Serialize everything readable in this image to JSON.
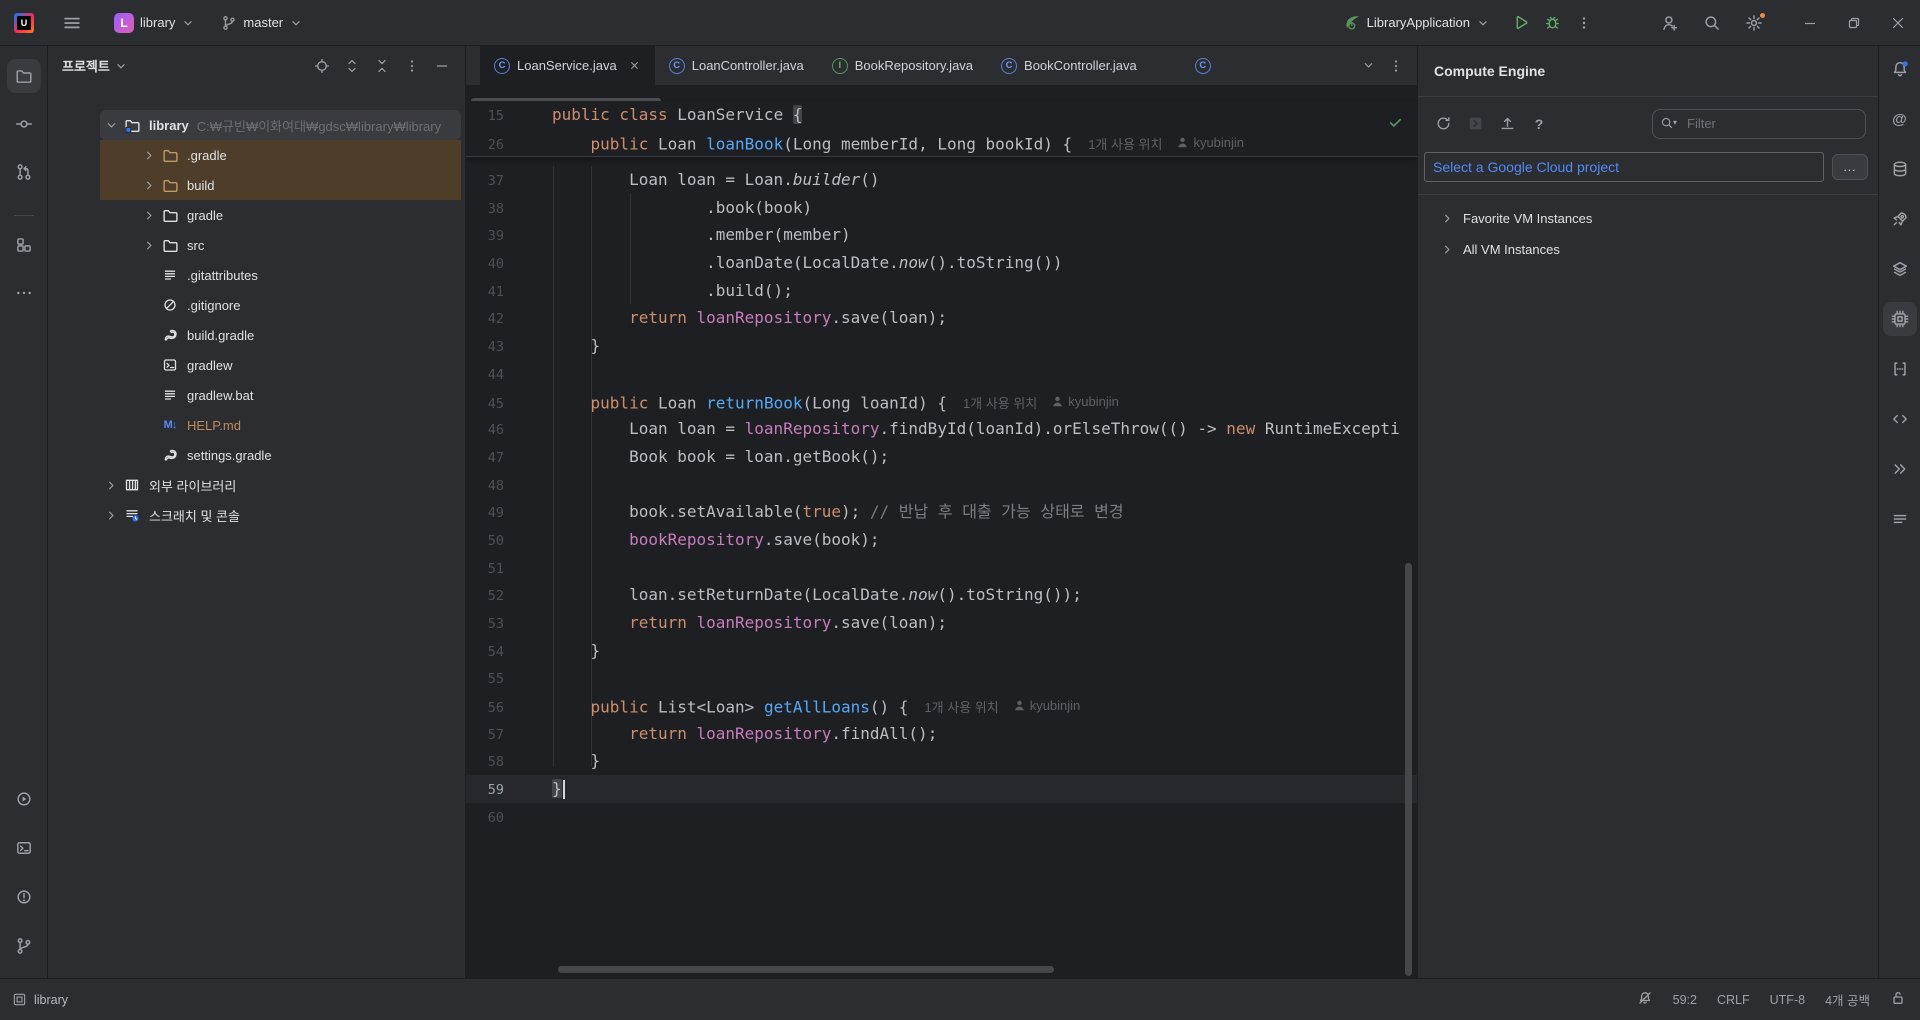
{
  "title_bar": {
    "project_name": "library",
    "branch": "master",
    "run_config": "LibraryApplication"
  },
  "left_stripe": {
    "top": [
      "project-folder",
      "commit",
      "pull-requests",
      "divider",
      "structure",
      "more-tool-windows"
    ],
    "bottom": [
      "services",
      "terminal",
      "problems",
      "version-control"
    ],
    "active": "project-folder"
  },
  "right_stripe": {
    "items": [
      "notifications-bell",
      "ai-spiral",
      "database",
      "deploy",
      "layers",
      "compute-engine",
      "cloud-brackets",
      "cloud-code",
      "run-anything",
      "build-lines"
    ],
    "active": "compute-engine"
  },
  "project_panel": {
    "title": "프로젝트",
    "header_icons": [
      "locate",
      "expand-all",
      "collapse-all",
      "more-vertical",
      "hide"
    ],
    "tree": [
      {
        "label": "library",
        "path": "C:₩규빈₩이화여대₩gdsc₩library₩library",
        "icon": "folder-module",
        "level": 0,
        "chevron": "down",
        "bg": "selected",
        "bold": true
      },
      {
        "label": ".gradle",
        "icon": "folder-ex",
        "level": 1,
        "chevron": "right",
        "bg": "excluded"
      },
      {
        "label": "build",
        "icon": "folder-ex",
        "level": 1,
        "chevron": "right",
        "bg": "excluded"
      },
      {
        "label": "gradle",
        "icon": "folder",
        "level": 1,
        "chevron": "right"
      },
      {
        "label": "src",
        "icon": "folder",
        "level": 1,
        "chevron": "right"
      },
      {
        "label": ".gitattributes",
        "icon": "file-lines",
        "level": 1
      },
      {
        "label": ".gitignore",
        "icon": "no-entry",
        "level": 1
      },
      {
        "label": "build.gradle",
        "icon": "gradle",
        "level": 1
      },
      {
        "label": "gradlew",
        "icon": "terminal-file",
        "level": 1
      },
      {
        "label": "gradlew.bat",
        "icon": "file-lines",
        "level": 1
      },
      {
        "label": "HELP.md",
        "icon": "markdown",
        "level": 1,
        "color": "ignored"
      },
      {
        "label": "settings.gradle",
        "icon": "gradle",
        "level": 1
      },
      {
        "label": "외부 라이브러리",
        "icon": "libraries",
        "level": 0,
        "chevron": "right"
      },
      {
        "label": "스크래치 및 콘솔",
        "icon": "scratches",
        "level": 0,
        "chevron": "right"
      }
    ]
  },
  "tabs": [
    {
      "label": "LoanService.java",
      "icon": "class",
      "active": true,
      "close": true
    },
    {
      "label": "LoanController.java",
      "icon": "class"
    },
    {
      "label": "BookRepository.java",
      "icon": "interface"
    },
    {
      "label": "BookController.java",
      "icon": "class"
    },
    {
      "label": "",
      "icon": "class",
      "icon_only": true
    }
  ],
  "editor": {
    "sticky": [
      {
        "n": "15",
        "seg": [
          [
            "sk",
            "public class "
          ],
          [
            "sd",
            "LoanService "
          ],
          [
            "sbh",
            "{"
          ]
        ]
      },
      {
        "n": "26",
        "seg": [
          [
            "sd",
            "    "
          ],
          [
            "sk",
            "public "
          ],
          [
            "sd",
            "Loan "
          ],
          [
            "sm",
            "loanBook"
          ],
          [
            "sd",
            "(Long memberId, Long bookId) {"
          ],
          [
            "hint",
            "1개 사용 위치"
          ],
          [
            "author",
            "kyubinjin"
          ]
        ]
      }
    ],
    "sliver_line": "36",
    "lines": [
      {
        "n": "37",
        "seg": [
          [
            "sd",
            "        Loan loan = Loan."
          ],
          [
            "sdi",
            "builder"
          ],
          [
            "sd",
            "()"
          ]
        ]
      },
      {
        "n": "38",
        "seg": [
          [
            "sd",
            "                .book(book)"
          ]
        ]
      },
      {
        "n": "39",
        "seg": [
          [
            "sd",
            "                .member(member)"
          ]
        ]
      },
      {
        "n": "40",
        "seg": [
          [
            "sd",
            "                .loanDate(LocalDate."
          ],
          [
            "sdi",
            "now"
          ],
          [
            "sd",
            "().toString())"
          ]
        ]
      },
      {
        "n": "41",
        "seg": [
          [
            "sd",
            "                .build();"
          ]
        ]
      },
      {
        "n": "42",
        "seg": [
          [
            "sd",
            "        "
          ],
          [
            "sk",
            "return "
          ],
          [
            "sf",
            "loanRepository"
          ],
          [
            "sd",
            ".save(loan);"
          ]
        ]
      },
      {
        "n": "43",
        "seg": [
          [
            "sd",
            "    }"
          ]
        ]
      },
      {
        "n": "44",
        "seg": []
      },
      {
        "n": "45",
        "seg": [
          [
            "sd",
            "    "
          ],
          [
            "sk",
            "public "
          ],
          [
            "sd",
            "Loan "
          ],
          [
            "sm",
            "returnBook"
          ],
          [
            "sd",
            "(Long loanId) {"
          ],
          [
            "hint",
            "1개 사용 위치"
          ],
          [
            "author",
            "kyubinjin"
          ]
        ]
      },
      {
        "n": "46",
        "seg": [
          [
            "sd",
            "        Loan loan = "
          ],
          [
            "sf",
            "loanRepository"
          ],
          [
            "sd",
            ".findById(loanId).orElseThrow(() -> "
          ],
          [
            "sk",
            "new"
          ],
          [
            "sd",
            " RuntimeExcepti"
          ]
        ]
      },
      {
        "n": "47",
        "seg": [
          [
            "sd",
            "        Book book = loan.getBook();"
          ]
        ]
      },
      {
        "n": "48",
        "seg": []
      },
      {
        "n": "49",
        "seg": [
          [
            "sd",
            "        book.setAvailable("
          ],
          [
            "sk",
            "true"
          ],
          [
            "sd",
            "); "
          ],
          [
            "sc",
            "// 반납 후 대출 가능 상태로 변경"
          ]
        ]
      },
      {
        "n": "50",
        "seg": [
          [
            "sd",
            "        "
          ],
          [
            "sf",
            "bookRepository"
          ],
          [
            "sd",
            ".save(book);"
          ]
        ]
      },
      {
        "n": "51",
        "seg": []
      },
      {
        "n": "52",
        "seg": [
          [
            "sd",
            "        loan.setReturnDate(LocalDate."
          ],
          [
            "sdi",
            "now"
          ],
          [
            "sd",
            "().toString());"
          ]
        ]
      },
      {
        "n": "53",
        "seg": [
          [
            "sd",
            "        "
          ],
          [
            "sk",
            "return "
          ],
          [
            "sf",
            "loanRepository"
          ],
          [
            "sd",
            ".save(loan);"
          ]
        ]
      },
      {
        "n": "54",
        "seg": [
          [
            "sd",
            "    }"
          ]
        ]
      },
      {
        "n": "55",
        "seg": []
      },
      {
        "n": "56",
        "seg": [
          [
            "sd",
            "    "
          ],
          [
            "sk",
            "public "
          ],
          [
            "sd",
            "List<Loan> "
          ],
          [
            "sm",
            "getAllLoans"
          ],
          [
            "sd",
            "() {"
          ],
          [
            "hint",
            "1개 사용 위치"
          ],
          [
            "author",
            "kyubinjin"
          ]
        ]
      },
      {
        "n": "57",
        "seg": [
          [
            "sd",
            "        "
          ],
          [
            "sk",
            "return "
          ],
          [
            "sf",
            "loanRepository"
          ],
          [
            "sd",
            ".findAll();"
          ]
        ]
      },
      {
        "n": "58",
        "seg": [
          [
            "sd",
            "    }"
          ]
        ]
      },
      {
        "n": "59",
        "seg": [
          [
            "sbh",
            "}"
          ],
          [
            "caret",
            ""
          ]
        ],
        "current": true
      },
      {
        "n": "60",
        "seg": []
      }
    ]
  },
  "gcp": {
    "title": "Compute Engine",
    "toolbar_icons": [
      "refresh",
      "run-script",
      "upload",
      "help"
    ],
    "filter_placeholder": "Filter",
    "project_selector": "Select a Google Cloud project",
    "more_label": "...",
    "tree": [
      {
        "label": "Favorite VM Instances"
      },
      {
        "label": "All VM Instances"
      }
    ]
  },
  "status_bar": {
    "project": "library",
    "items": [
      "59:2",
      "CRLF",
      "UTF-8",
      "4개 공백"
    ]
  },
  "colors": {
    "panel_bg": "#2b2d30",
    "editor_bg": "#1e1f22",
    "selection_row": "#393b40",
    "excluded_row": "#4d3d29",
    "keyword": "#cf8e6d",
    "method": "#56a8f5",
    "field": "#c77dbb",
    "comment": "#7a7e85",
    "default_text": "#bcbec4",
    "hint": "#5e6167",
    "link_blue": "#548af7",
    "green": "#5fad65",
    "check_green": "#57965c",
    "gear_badge": "#f28b3a",
    "bell_badge": "#3574f0",
    "ignored_file": "#c08a5c"
  }
}
